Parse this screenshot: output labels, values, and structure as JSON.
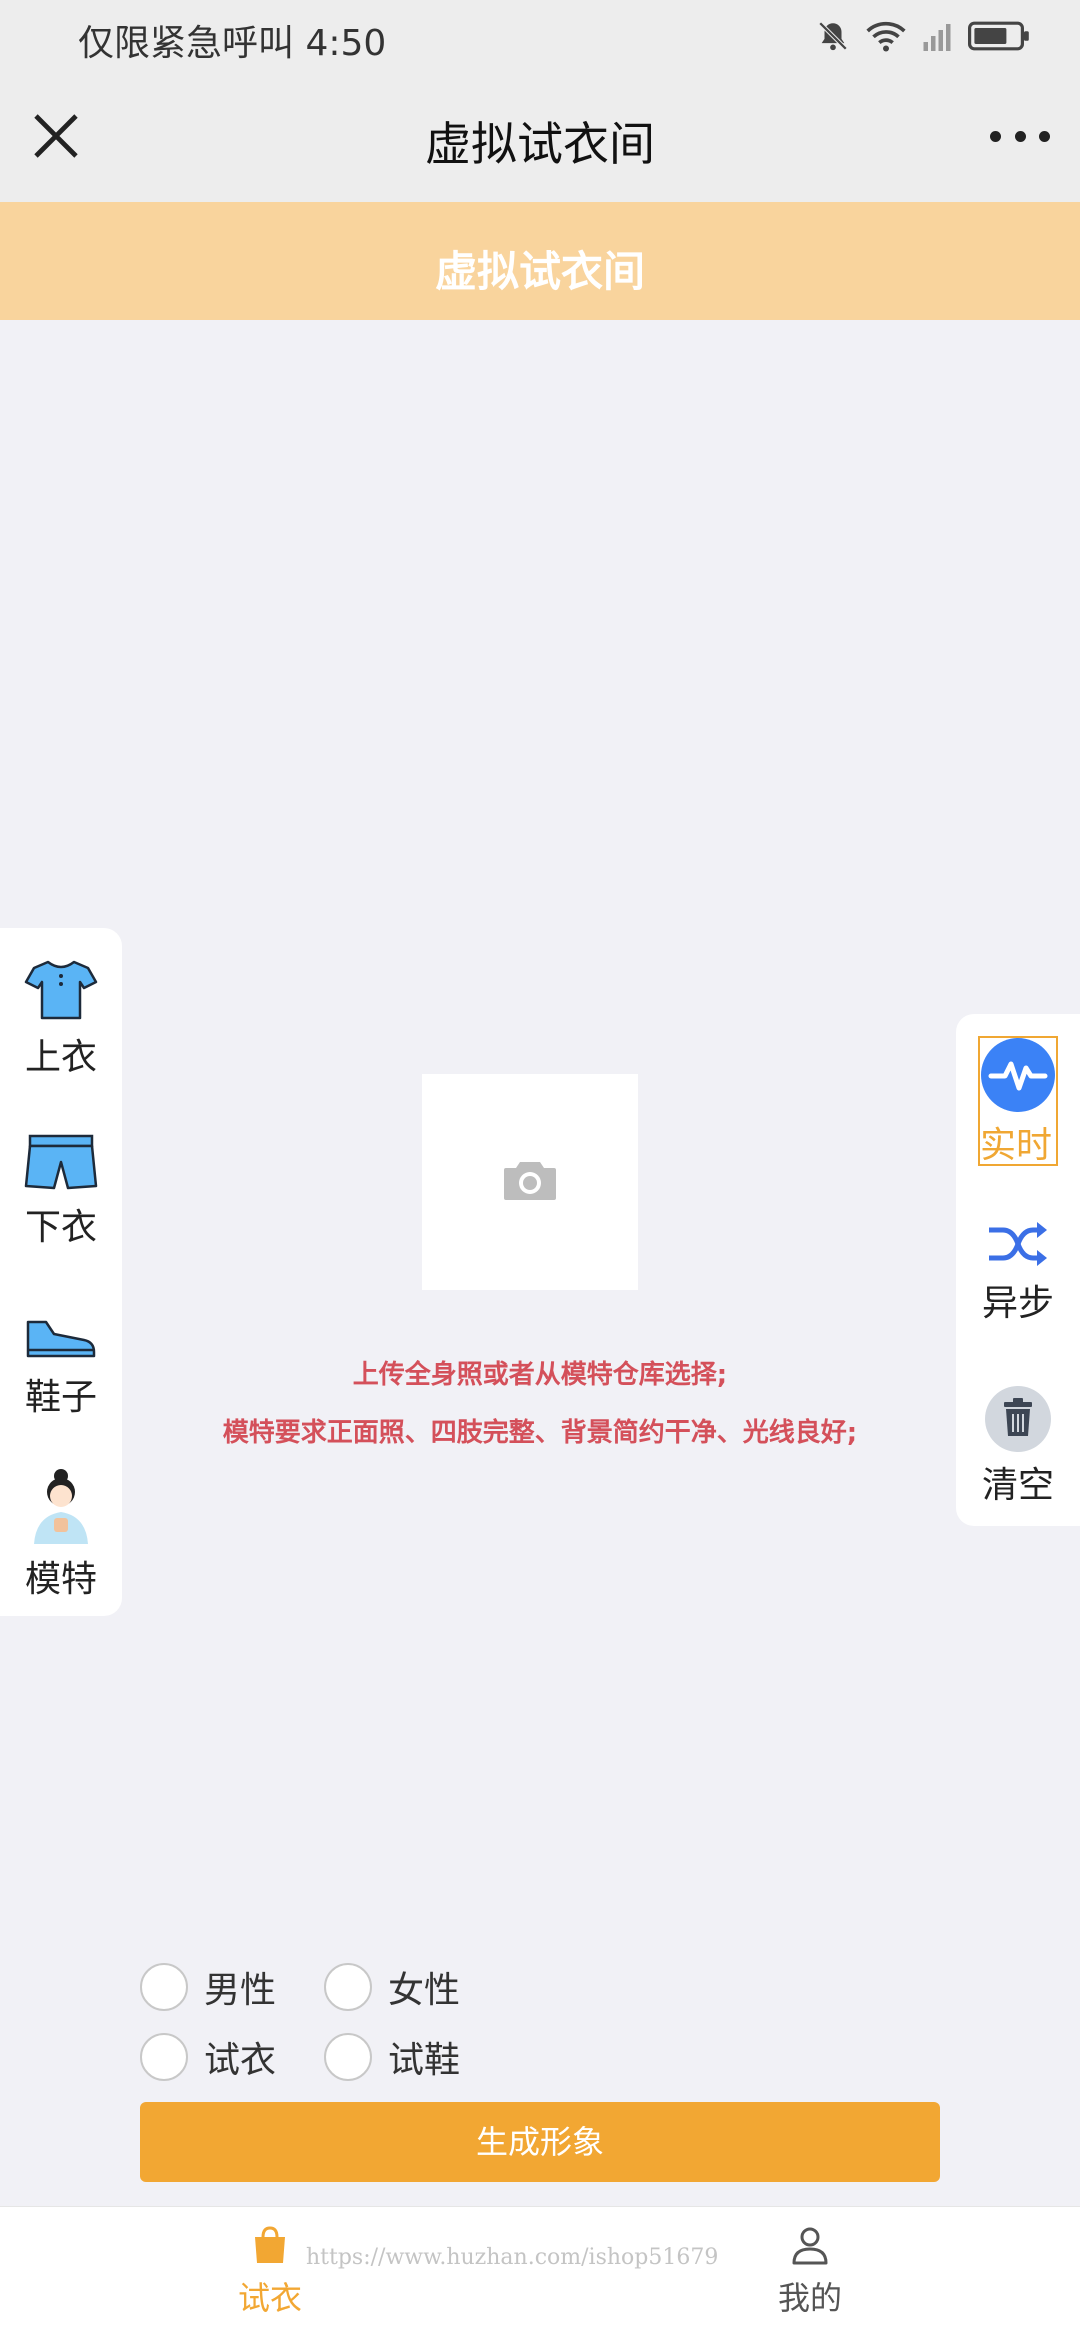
{
  "status_bar": {
    "text": "仅限紧急呼叫 4:50",
    "icons": [
      "bell-off-icon",
      "wifi-icon",
      "signal-icon",
      "battery-icon"
    ]
  },
  "nav": {
    "title": "虚拟试衣间",
    "icons": [
      "close-icon",
      "more-icon"
    ]
  },
  "banner": {
    "title": "虚拟试衣间"
  },
  "left_tools": [
    {
      "label": "上衣",
      "icon": "shirt-icon"
    },
    {
      "label": "下衣",
      "icon": "shorts-icon"
    },
    {
      "label": "鞋子",
      "icon": "shoe-icon"
    },
    {
      "label": "模特",
      "icon": "model-icon"
    }
  ],
  "right_tools": [
    {
      "label": "实时",
      "icon": "pulse-icon",
      "active": true
    },
    {
      "label": "异步",
      "icon": "shuffle-icon"
    },
    {
      "label": "清空",
      "icon": "trash-icon"
    }
  ],
  "upload": {
    "icon": "camera-icon"
  },
  "hints": [
    "上传全身照或者从模特仓库选择;",
    "模特要求正面照、四肢完整、背景简约干净、光线良好;"
  ],
  "options": {
    "gender": [
      "男性",
      "女性"
    ],
    "mode": [
      "试衣",
      "试鞋"
    ]
  },
  "generate_button": "生成形象",
  "tabs": [
    {
      "label": "试衣",
      "icon": "shopping-bag-icon",
      "active": true
    },
    {
      "label": "我的",
      "icon": "user-icon",
      "active": false
    }
  ],
  "watermark": "https://www.huzhan.com/ishop51679",
  "colors": {
    "accent": "#f2a733",
    "banner": "#f9d49d",
    "hint": "#d4505a",
    "icon_blue": "#3b82f6"
  }
}
